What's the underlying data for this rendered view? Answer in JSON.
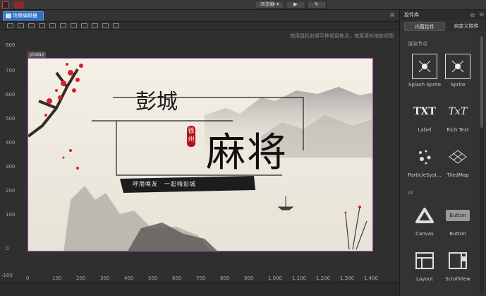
{
  "topbar": {
    "preview_label": "浏览器",
    "play_icon": "play-icon",
    "refresh_icon": "refresh-icon"
  },
  "editor": {
    "tab_label": "场景编辑器",
    "hint": "使用鼠标右键平移视窗焦点，使用滚轮缩放视图",
    "canvas_name": "yindao",
    "y_ticks": [
      "800",
      "700",
      "600",
      "500",
      "400",
      "300",
      "200",
      "100",
      "0",
      "-100"
    ],
    "x_ticks": [
      "-100",
      "0",
      "100",
      "200",
      "300",
      "400",
      "500",
      "600",
      "700",
      "800",
      "900",
      "1,000",
      "1,100",
      "1,200",
      "1,300",
      "1,400"
    ]
  },
  "artwork": {
    "title_top": "彭城",
    "title_main": "麻将",
    "seal": "徐州",
    "slogan": "呼朋唤友　一起嗨彭城"
  },
  "panel": {
    "title": "控件库",
    "tabs": [
      {
        "label": "内置控件"
      },
      {
        "label": "自定义控件"
      }
    ],
    "section_render": "渲染节点",
    "section_ui": "UI",
    "render_items": [
      {
        "label": "Splash Sprite",
        "icon": "splash-sprite-icon"
      },
      {
        "label": "Sprite",
        "icon": "sprite-icon"
      },
      {
        "label": "Label",
        "icon": "label-txt-icon",
        "glyph": "TXT"
      },
      {
        "label": "Rich Text",
        "icon": "richtext-icon",
        "glyph": "TxT"
      },
      {
        "label": "ParticleSyst...",
        "icon": "particle-icon"
      },
      {
        "label": "TiledMap",
        "icon": "tiledmap-icon"
      }
    ],
    "ui_items": [
      {
        "label": "Canvas",
        "icon": "canvas-icon"
      },
      {
        "label": "Button",
        "icon": "button-icon",
        "glyph": "Button"
      },
      {
        "label": "Layout",
        "icon": "layout-icon"
      },
      {
        "label": "ScrollView",
        "icon": "scrollview-icon"
      }
    ]
  },
  "colors": {
    "accent": "#2e6fc4",
    "canvas_border": "#b04fb0",
    "seal_red": "#b5121b"
  }
}
